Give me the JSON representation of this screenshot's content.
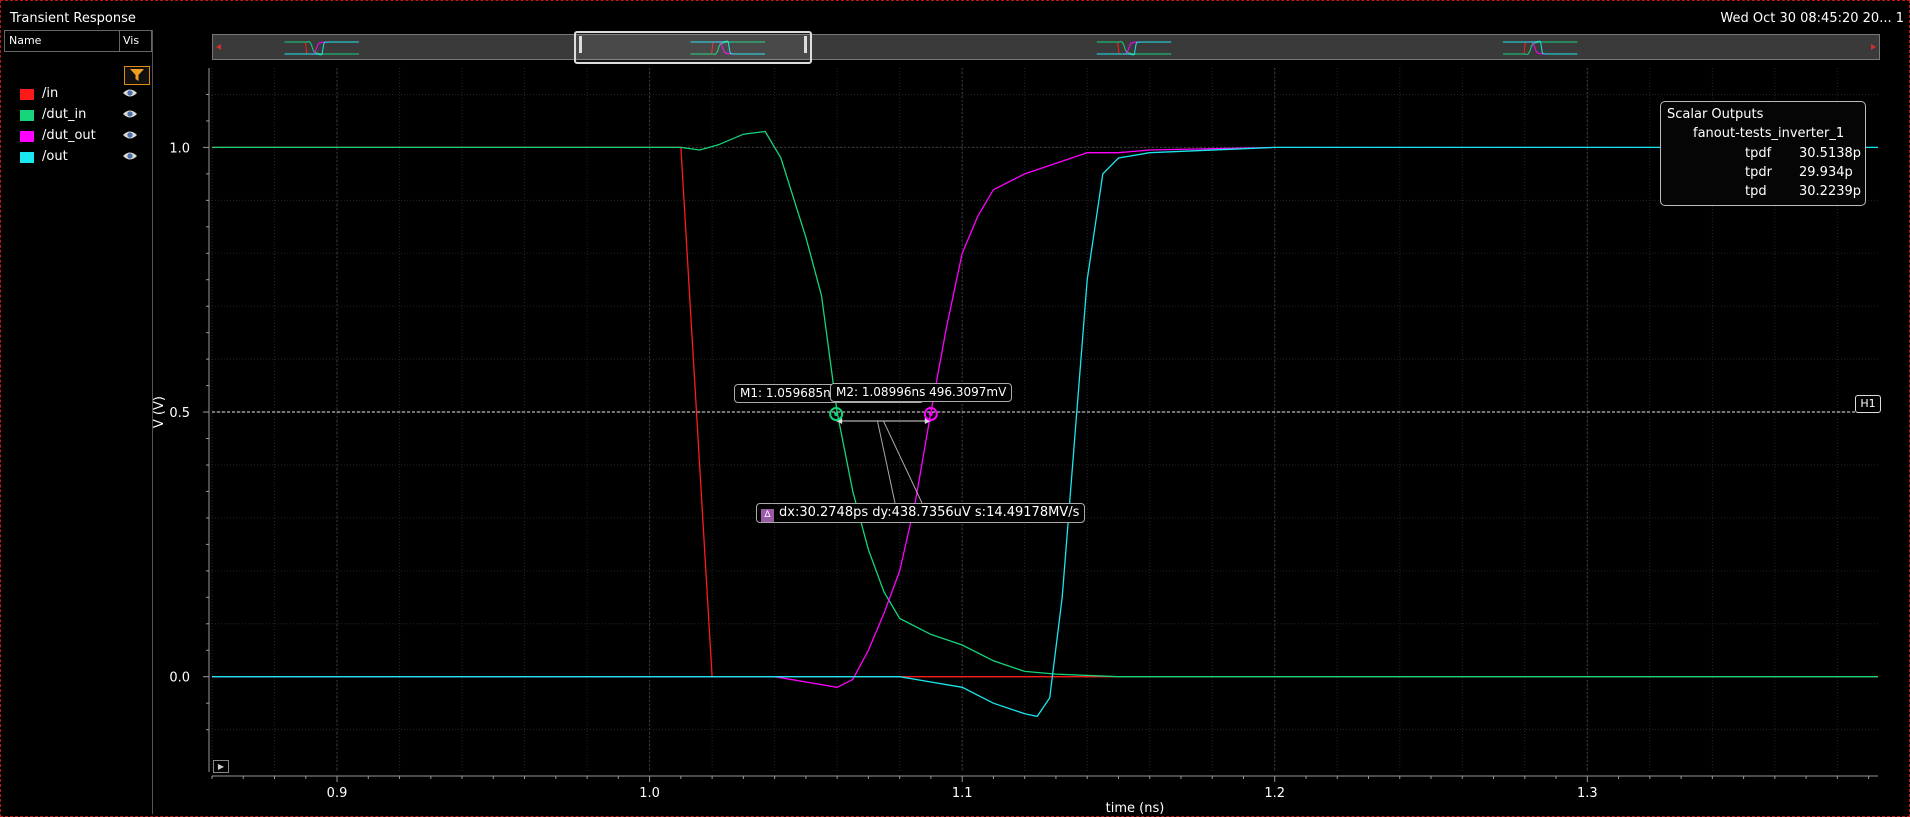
{
  "window": {
    "title": "Transient Response",
    "datetime": "Wed Oct 30 08:45:20 20... 1"
  },
  "legend": {
    "col_name": "Name",
    "col_vis": "Vis",
    "filter_icon": "funnel-icon",
    "items": [
      {
        "label": "/in",
        "color": "#ff1a1a"
      },
      {
        "label": "/dut_in",
        "color": "#16d47a"
      },
      {
        "label": "/dut_out",
        "color": "#ff00ff"
      },
      {
        "label": "/out",
        "color": "#19e6ee"
      }
    ],
    "vis_icon": "eye-icon"
  },
  "scalar_outputs": {
    "title": "Scalar Outputs",
    "test": "fanout-tests_inverter_1",
    "rows": [
      {
        "name": "tpdf",
        "value": "30.5138p"
      },
      {
        "name": "tpdr",
        "value": "29.934p"
      },
      {
        "name": "tpd",
        "value": "30.2239p"
      }
    ]
  },
  "markers": {
    "m1": "M1: 1.059685ns 496.3097mV",
    "m2": "M2: 1.08996ns 496.3097mV",
    "delta": "dx:30.2748ps dy:438.7356uV s:14.49178MV/s",
    "delta_icon": "Δ",
    "hline": "H1"
  },
  "chart_data": {
    "type": "line",
    "xlabel": "time (ns)",
    "ylabel": "V (V)",
    "xlim": [
      0.86,
      1.393
    ],
    "ylim": [
      -0.18,
      1.15
    ],
    "xticks": [
      0.9,
      1.0,
      1.1,
      1.2,
      1.3
    ],
    "xtick_labels": [
      "0.9",
      "1.0",
      "1.1",
      "1.2",
      "1.3"
    ],
    "yticks": [
      0.0,
      0.5,
      1.0
    ],
    "ytick_labels": [
      "0.0",
      "0.5",
      "1.0"
    ],
    "grid": true,
    "hline_value": 0.5,
    "marker_points": [
      {
        "x": 1.059685,
        "y": 0.4963
      },
      {
        "x": 1.08996,
        "y": 0.4963
      }
    ],
    "series": [
      {
        "name": "/in",
        "color": "#ff1a1a",
        "x": [
          0.86,
          1.01,
          1.02,
          1.06,
          1.19,
          1.393
        ],
        "y": [
          1.0,
          1.0,
          0.0,
          0.0,
          0.0,
          0.0
        ]
      },
      {
        "name": "/dut_in",
        "color": "#16d47a",
        "x": [
          0.86,
          1.01,
          1.016,
          1.022,
          1.03,
          1.037,
          1.042,
          1.05,
          1.055,
          1.06,
          1.065,
          1.07,
          1.075,
          1.08,
          1.09,
          1.1,
          1.11,
          1.12,
          1.13,
          1.15,
          1.393
        ],
        "y": [
          1.0,
          1.0,
          0.995,
          1.005,
          1.025,
          1.03,
          0.98,
          0.83,
          0.72,
          0.5,
          0.35,
          0.24,
          0.16,
          0.11,
          0.08,
          0.06,
          0.03,
          0.01,
          0.005,
          0.0,
          0.0
        ]
      },
      {
        "name": "/dut_out",
        "color": "#ff00ff",
        "x": [
          0.86,
          1.04,
          1.05,
          1.06,
          1.065,
          1.07,
          1.075,
          1.08,
          1.085,
          1.09,
          1.095,
          1.1,
          1.105,
          1.11,
          1.12,
          1.135,
          1.14,
          1.15,
          1.16,
          1.2
        ],
        "y": [
          0.0,
          0.0,
          -0.01,
          -0.02,
          -0.005,
          0.05,
          0.12,
          0.2,
          0.33,
          0.5,
          0.66,
          0.8,
          0.87,
          0.92,
          0.95,
          0.98,
          0.99,
          0.99,
          0.995,
          1.0
        ]
      },
      {
        "name": "/out",
        "color": "#19e6ee",
        "x": [
          0.86,
          1.08,
          1.09,
          1.1,
          1.11,
          1.12,
          1.124,
          1.128,
          1.132,
          1.136,
          1.14,
          1.145,
          1.15,
          1.16,
          1.2,
          1.393
        ],
        "y": [
          0.0,
          0.0,
          -0.01,
          -0.02,
          -0.05,
          -0.07,
          -0.075,
          -0.04,
          0.15,
          0.45,
          0.75,
          0.95,
          0.98,
          0.99,
          1.0,
          1.0
        ]
      }
    ]
  }
}
